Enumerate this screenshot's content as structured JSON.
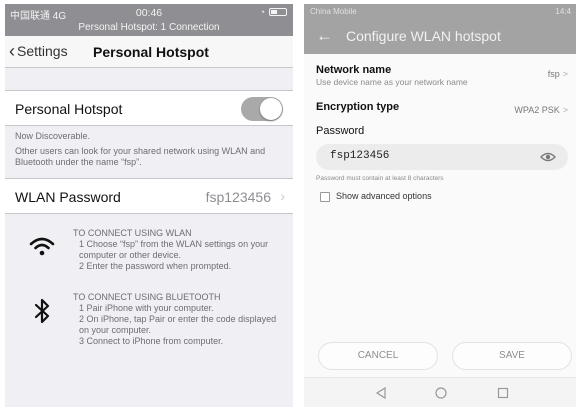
{
  "ios": {
    "status": {
      "carrier": "中国联通 4G",
      "time": "00:46"
    },
    "hotspot_banner": "Personal Hotspot: 1 Connection",
    "nav": {
      "back_label": "Settings",
      "title": "Personal Hotspot"
    },
    "hotspot_toggle": {
      "label": "Personal Hotspot",
      "on": true
    },
    "discoverable_note": "Now Discoverable.",
    "discoverable_detail": "Other users can look for your shared network using WLAN and Bluetooth under the name “fsp”.",
    "wlan_password": {
      "label": "WLAN Password",
      "value": "fsp123456"
    },
    "wlan_instructions": {
      "heading": "TO CONNECT USING WLAN",
      "steps": [
        "1 Choose “fsp” from the WLAN settings on your computer or other device.",
        "2 Enter the password when prompted."
      ],
      "icon": "wifi-icon"
    },
    "bluetooth_instructions": {
      "heading": "TO CONNECT USING BLUETOOTH",
      "steps": [
        "1 Pair iPhone with your computer.",
        "2 On iPhone, tap Pair or enter the code displayed on your computer.",
        "3 Connect to iPhone from computer."
      ],
      "icon": "bluetooth-icon"
    }
  },
  "android": {
    "status": {
      "carrier": "China Mobile",
      "right": "14:4"
    },
    "toolbar": {
      "title": "Configure WLAN hotspot"
    },
    "network_name": {
      "label": "Network name",
      "sub": "Use device name as your network name",
      "value": "fsp"
    },
    "encryption": {
      "label": "Encryption type",
      "value": "WPA2 PSK"
    },
    "password": {
      "label": "Password",
      "value": "fsp123456",
      "hint": "Password must contain at least 8 characters"
    },
    "advanced": {
      "label": "Show advanced options",
      "checked": false
    },
    "buttons": {
      "cancel": "CANCEL",
      "save": "SAVE"
    }
  },
  "colors": {
    "ios_bar": "#8e8e93",
    "android_bar": "#a3a3a3",
    "toggle_on": "#a9a9a9"
  }
}
